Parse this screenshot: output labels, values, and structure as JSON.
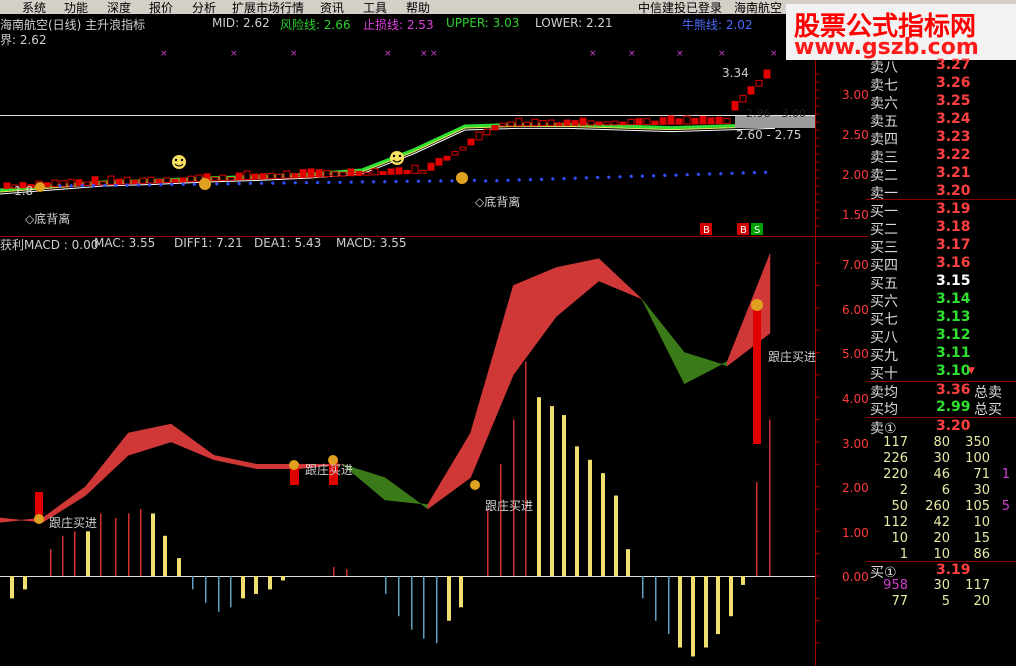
{
  "menu": {
    "items": [
      "系统",
      "功能",
      "深度",
      "报价",
      "分析",
      "扩展市场行情",
      "资讯",
      "工具",
      "帮助"
    ],
    "broker": "中信建投已登录",
    "stock": "海南航空"
  },
  "watermark": {
    "line1": "股票公式指标网",
    "line2": "www.gszb.com"
  },
  "upper_panel": {
    "title": "海南航空(日线) 主升浪指标",
    "mid_label": "MID: 2.62",
    "risk_label": "风险线: 2.66",
    "stop_label": "止损线: 2.53",
    "upper_label": "UPPER: 3.03",
    "lower_label": "LOWER: 2.21",
    "bull_label": "牛熊线: 2.02",
    "line2": "界: 2.62",
    "price_high": "3.34",
    "price_mid1": "2.96 - 3.00",
    "price_mid2": "2.60 - 2.75",
    "price_low": "1.8",
    "divergence_labels": [
      "◇底背离",
      "◇底背离"
    ],
    "signals": [
      "B",
      "B",
      "S"
    ],
    "y_axis": [
      "3.00",
      "2.50",
      "2.00",
      "1.50"
    ]
  },
  "lower_panel": {
    "title": "获利MACD : 0.00",
    "mac_label": "MAC: 3.55",
    "diff_label": "DIFF1: 7.21",
    "dea_label": "DEA1: 5.43",
    "macd_label": "MACD: 3.55",
    "follow_labels": [
      "跟庄买进",
      "跟庄买进",
      "跟庄买进",
      "跟庄买进"
    ],
    "y_axis": [
      "7.00",
      "6.00",
      "5.00",
      "4.00",
      "3.00",
      "2.00",
      "1.00",
      "0.00"
    ]
  },
  "order_book": {
    "asks": [
      {
        "label": "卖八",
        "price": "3.27",
        "color": "#ff4040"
      },
      {
        "label": "卖七",
        "price": "3.26",
        "color": "#ff4040"
      },
      {
        "label": "卖六",
        "price": "3.25",
        "color": "#ff4040"
      },
      {
        "label": "卖五",
        "price": "3.24",
        "color": "#ff4040"
      },
      {
        "label": "卖四",
        "price": "3.23",
        "color": "#ff4040"
      },
      {
        "label": "卖三",
        "price": "3.22",
        "color": "#ff4040"
      },
      {
        "label": "卖二",
        "price": "3.21",
        "color": "#ff4040"
      },
      {
        "label": "卖一",
        "price": "3.20",
        "color": "#ff4040"
      }
    ],
    "bids": [
      {
        "label": "买一",
        "price": "3.19",
        "color": "#ff4040"
      },
      {
        "label": "买二",
        "price": "3.18",
        "color": "#ff4040"
      },
      {
        "label": "买三",
        "price": "3.17",
        "color": "#ff4040"
      },
      {
        "label": "买四",
        "price": "3.16",
        "color": "#ff4040"
      },
      {
        "label": "买五",
        "price": "3.15",
        "color": "#ffffff"
      },
      {
        "label": "买六",
        "price": "3.14",
        "color": "#30e030"
      },
      {
        "label": "买七",
        "price": "3.13",
        "color": "#30e030"
      },
      {
        "label": "买八",
        "price": "3.12",
        "color": "#30e030"
      },
      {
        "label": "买九",
        "price": "3.11",
        "color": "#30e030"
      },
      {
        "label": "买十",
        "price": "3.10",
        "color": "#30e030"
      }
    ],
    "avg_sell_label": "卖均",
    "avg_sell": "3.36",
    "total_sell": "总卖",
    "avg_buy_label": "买均",
    "avg_buy": "2.99",
    "total_buy": "总买",
    "sell1_label": "卖①",
    "sell1_price": "3.20",
    "sell_queue": [
      [
        "117",
        "80",
        "350"
      ],
      [
        "226",
        "30",
        "100"
      ],
      [
        "220",
        "46",
        "71",
        "1"
      ],
      [
        "2",
        "6",
        "30"
      ],
      [
        "50",
        "260",
        "105",
        "5"
      ],
      [
        "112",
        "42",
        "10"
      ],
      [
        "10",
        "20",
        "15"
      ],
      [
        "1",
        "10",
        "86"
      ]
    ],
    "buy1_label": "买①",
    "buy1_price": "3.19",
    "buy_queue": [
      [
        "958",
        "30",
        "117"
      ],
      [
        "77",
        "5",
        "20"
      ]
    ]
  },
  "chart_data": [
    {
      "type": "line",
      "title": "海南航空(日线) 主升浪指标",
      "ylim": [
        1.3,
        3.35
      ],
      "y_ticks": [
        1.5,
        2.0,
        2.5,
        3.0
      ],
      "series": [
        {
          "name": "MID",
          "values": [
            1.8,
            1.85,
            1.9,
            1.92,
            1.95,
            1.97,
            2.0,
            2.05,
            2.3,
            2.6,
            2.62,
            2.62,
            2.6,
            2.58,
            2.6,
            2.62
          ]
        },
        {
          "name": "UPPER",
          "values": [
            3.03
          ]
        },
        {
          "name": "LOWER",
          "values": [
            2.21
          ]
        }
      ]
    },
    {
      "type": "area",
      "title": "获利MACD",
      "ylim": [
        -1.7,
        7.4
      ],
      "y_ticks": [
        0,
        1,
        2,
        3,
        4,
        5,
        6,
        7
      ],
      "series": [
        {
          "name": "DIFF1",
          "values": [
            1.2,
            1.3,
            2.0,
            3.2,
            3.4,
            2.7,
            2.5,
            2.5,
            2.5,
            1.7,
            1.6,
            3.2,
            6.5,
            6.9,
            7.1,
            6.2,
            4.3,
            4.8,
            7.21
          ]
        },
        {
          "name": "DEA1",
          "values": [
            1.3,
            1.2,
            1.8,
            2.7,
            3.0,
            2.6,
            2.4,
            2.4,
            2.5,
            2.2,
            1.5,
            2.2,
            4.5,
            5.8,
            6.6,
            6.2,
            5.0,
            4.7,
            5.43
          ]
        }
      ]
    }
  ]
}
